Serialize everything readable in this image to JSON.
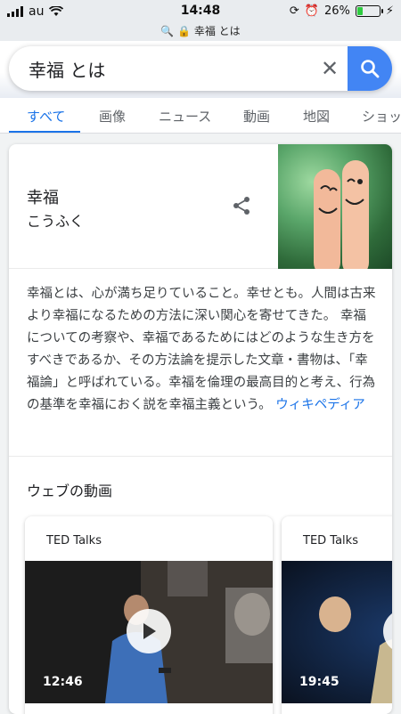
{
  "status_bar": {
    "carrier": "au",
    "time": "14:48",
    "battery": "26%",
    "battery_level": 0.26
  },
  "url_bar": {
    "text": "幸福 とは"
  },
  "search": {
    "query": "幸福 とは"
  },
  "tabs": [
    {
      "label": "すべて",
      "active": true
    },
    {
      "label": "画像"
    },
    {
      "label": "ニュース"
    },
    {
      "label": "動画"
    },
    {
      "label": "地図"
    },
    {
      "label": "ショッピング"
    }
  ],
  "knowledge_panel": {
    "title": "幸福",
    "reading": "こうふく",
    "description": "幸福とは、心が満ち足りていること。幸せとも。人間は古来より幸福になるための方法に深い関心を寄せてきた。 幸福についての考察や、幸福であるためにはどのような生き方をすべきであるか、その方法論を提示した文章・書物は、「幸福論」と呼ばれている。幸福を倫理の最高目的と考え、行為の基準を幸福におく説を幸福主義という。",
    "source_link": "ウィキペディア"
  },
  "videos": {
    "section_title": "ウェブの動画",
    "items": [
      {
        "source": "TED Talks",
        "duration": "12:46"
      },
      {
        "source": "TED Talks",
        "duration": "19:45"
      }
    ]
  },
  "colors": {
    "accent": "#1a73e8",
    "search_button": "#4285f4"
  }
}
